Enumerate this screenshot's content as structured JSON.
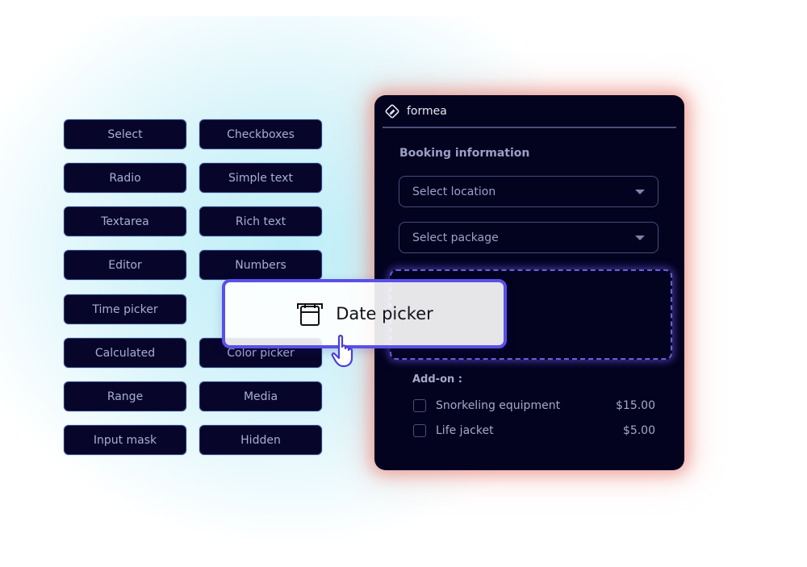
{
  "palette": {
    "items": [
      {
        "label": "Select"
      },
      {
        "label": "Checkboxes"
      },
      {
        "label": "Radio"
      },
      {
        "label": "Simple text"
      },
      {
        "label": "Textarea"
      },
      {
        "label": "Rich text"
      },
      {
        "label": "Editor"
      },
      {
        "label": "Numbers"
      },
      {
        "label": "Time picker"
      },
      {
        "label": "Date picker"
      },
      {
        "label": "Calculated"
      },
      {
        "label": "Color picker"
      },
      {
        "label": "Range"
      },
      {
        "label": "Media"
      },
      {
        "label": "Input mask"
      },
      {
        "label": "Hidden"
      }
    ]
  },
  "form": {
    "brand": "formea",
    "brand_icon": "formea-logo-icon",
    "section_title": "Booking information",
    "selects": [
      {
        "placeholder": "Select location",
        "icon": "caret-down-icon"
      },
      {
        "placeholder": "Select package",
        "icon": "caret-down-icon"
      }
    ],
    "addon_title": "Add-on :",
    "addons": [
      {
        "label": "Snorkeling equipment",
        "price": "$15.00",
        "checked": false
      },
      {
        "label": "Life jacket",
        "price": "$5.00",
        "checked": false
      }
    ]
  },
  "drag": {
    "label": "Date picker",
    "icon": "calendar-icon",
    "cursor": "hand-pointer-icon"
  },
  "colors": {
    "accent": "#5a50e8",
    "card_bg": "#03021f",
    "glow": "#e6786e"
  }
}
